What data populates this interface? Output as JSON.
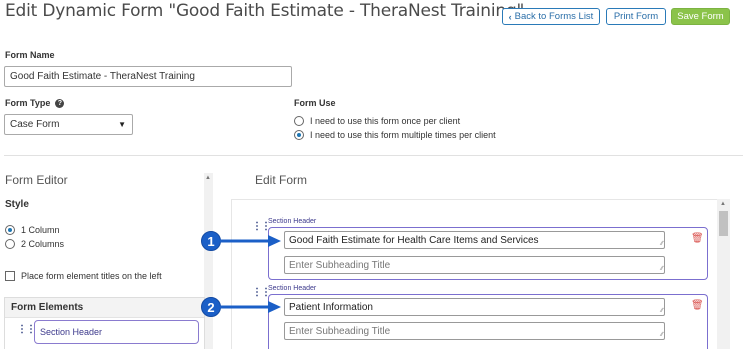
{
  "header": {
    "title": "Edit Dynamic Form \"Good Faith Estimate - TheraNest Training\"",
    "back_label": "Back to Forms List",
    "print_label": "Print Form",
    "save_label": "Save Form"
  },
  "form": {
    "name_label": "Form Name",
    "name_value": "Good Faith Estimate - TheraNest Training",
    "type_label": "Form Type",
    "type_value": "Case Form",
    "use_label": "Form Use",
    "use_options": [
      {
        "label": "I need to use this form once per client",
        "selected": false
      },
      {
        "label": "I need to use this form multiple times per client",
        "selected": true
      }
    ]
  },
  "form_editor": {
    "title": "Form Editor",
    "style_label": "Style",
    "columns": [
      {
        "label": "1 Column",
        "selected": true
      },
      {
        "label": "2 Columns",
        "selected": false
      }
    ],
    "titles_left_label": "Place form element titles on the left",
    "titles_left_checked": false,
    "elements_title": "Form Elements",
    "elements": [
      "Section Header"
    ]
  },
  "edit_form": {
    "title": "Edit Form",
    "sections": [
      {
        "tag": "Section Header",
        "title_value": "Good Faith Estimate for Health Care Items and Services",
        "subheading_placeholder": "Enter Subheading Title",
        "callout": "1"
      },
      {
        "tag": "Section Header",
        "title_value": "Patient Information",
        "subheading_placeholder": "Enter Subheading Title",
        "callout": "2"
      }
    ]
  },
  "colors": {
    "accent": "#2a7ab8",
    "save": "#8bc34a",
    "section_border": "#7b6fcf",
    "callout": "#1b5fc7",
    "trash": "#d9534f"
  }
}
